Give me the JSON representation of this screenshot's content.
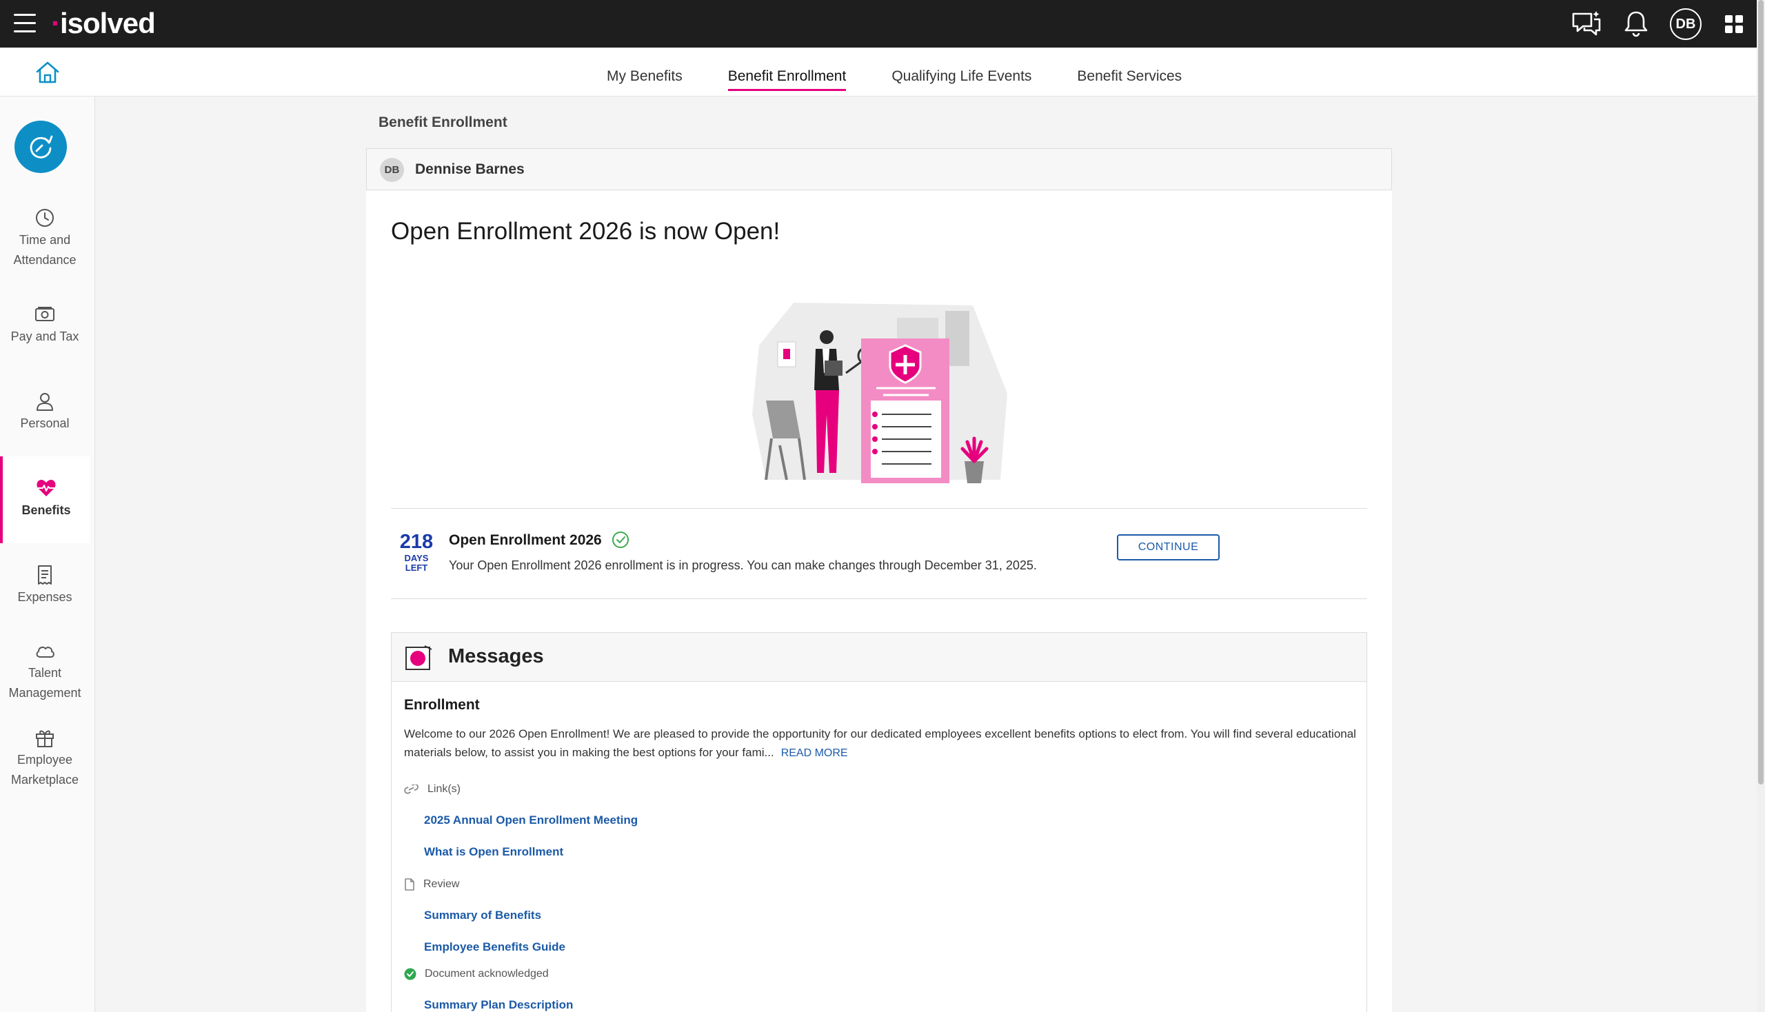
{
  "app": {
    "logo_dot": "·",
    "logo_text": "isolved"
  },
  "topbar": {
    "user_initials": "DB"
  },
  "tabs": [
    {
      "label": "My Benefits"
    },
    {
      "label": "Benefit Enrollment"
    },
    {
      "label": "Qualifying Life Events"
    },
    {
      "label": "Benefit Services"
    }
  ],
  "sidebar": {
    "items": [
      {
        "label_1": "Time and",
        "label_2": "Attendance"
      },
      {
        "label_1": "Pay and Tax"
      },
      {
        "label_1": "Personal"
      },
      {
        "label_1": "Benefits"
      },
      {
        "label_1": "Expenses"
      },
      {
        "label_1": "Talent",
        "label_2": "Management"
      },
      {
        "label_1": "Employee",
        "label_2": "Marketplace"
      }
    ]
  },
  "page": {
    "title": "Benefit Enrollment",
    "user_initials": "DB",
    "user_name": "Dennise Barnes",
    "headline": "Open Enrollment 2026 is now Open!"
  },
  "enrollment": {
    "days_left": "218",
    "days_label_1": "DAYS",
    "days_label_2": "LEFT",
    "title": "Open Enrollment 2026",
    "description": "Your Open Enrollment 2026 enrollment is in progress. You can make changes through December 31, 2025.",
    "continue_label": "CONTINUE"
  },
  "messages": {
    "title": "Messages",
    "section_title": "Enrollment",
    "body": "Welcome to our 2026 Open Enrollment! We are pleased to provide the opportunity for our dedicated employees excellent benefits options to elect from. You will find several educational materials below, to assist you in making the best options for your fami...",
    "read_more": "READ MORE",
    "links_label": "Link(s)",
    "links": [
      "2025 Annual Open Enrollment Meeting",
      "What is Open Enrollment"
    ],
    "review_label": "Review",
    "review_links": [
      "Summary of Benefits",
      "Employee Benefits Guide"
    ],
    "acknowledged_label": "Document acknowledged",
    "extra_link": "Summary Plan Description"
  },
  "colors": {
    "accent": "#e6007e",
    "link": "#1b5aa8",
    "brand_blue": "#0d8fc6",
    "days_blue": "#1b3ba8"
  }
}
